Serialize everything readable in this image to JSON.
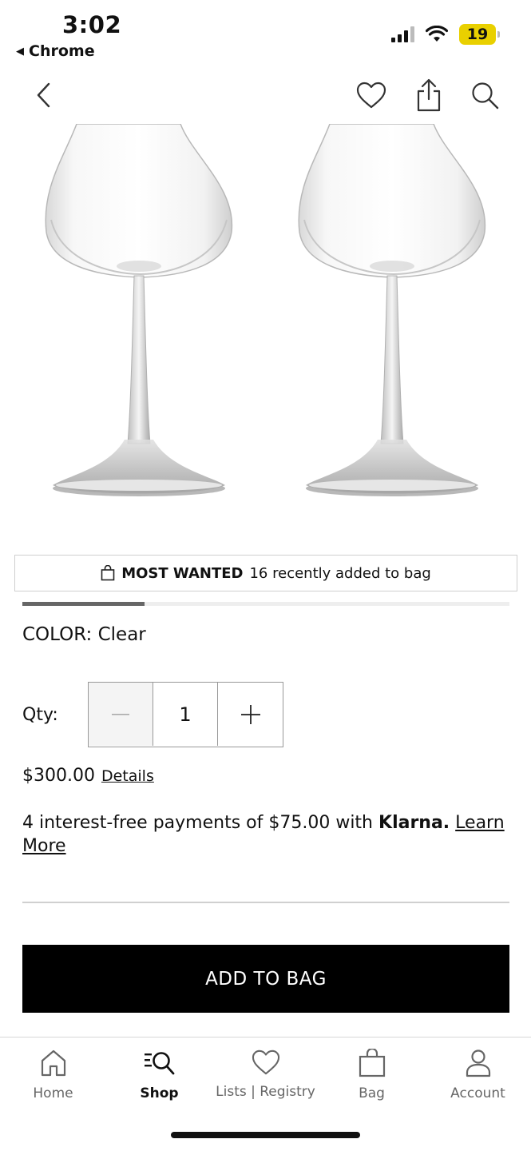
{
  "status_bar": {
    "time": "3:02",
    "back_app": "Chrome",
    "battery": "19"
  },
  "header": {
    "back_icon": "chevron-left-icon",
    "favorite_icon": "heart-icon",
    "share_icon": "share-icon",
    "search_icon": "search-icon"
  },
  "banner": {
    "bold": "MOST WANTED",
    "text": "16 recently added to bag",
    "icon": "bag-icon"
  },
  "carousel": {
    "position_fraction": 0.25
  },
  "color": {
    "label": "COLOR:",
    "value": "Clear"
  },
  "quantity": {
    "label": "Qty:",
    "minus": "−",
    "value": "1",
    "plus": "+"
  },
  "price": {
    "amount": "$300.00",
    "details_link": "Details"
  },
  "klarna": {
    "prefix": "4 interest-free payments of $75.00 with",
    "brand": "Klarna.",
    "link_learn": "Learn",
    "link_more": "More"
  },
  "cta": {
    "add_to_bag": "ADD TO BAG"
  },
  "tabs": [
    {
      "label": "Home",
      "icon": "home-icon",
      "active": false
    },
    {
      "label": "Shop",
      "icon": "shop-search-icon",
      "active": true
    },
    {
      "label": "Lists | Registry",
      "icon": "heart-icon",
      "active": false
    },
    {
      "label": "Bag",
      "icon": "bag-icon",
      "active": false
    },
    {
      "label": "Account",
      "icon": "account-icon",
      "active": false
    }
  ],
  "colors": {
    "cta_background": "#000000",
    "accent_text": "#111111",
    "muted_text": "#666666",
    "battery": "#e9d000"
  }
}
